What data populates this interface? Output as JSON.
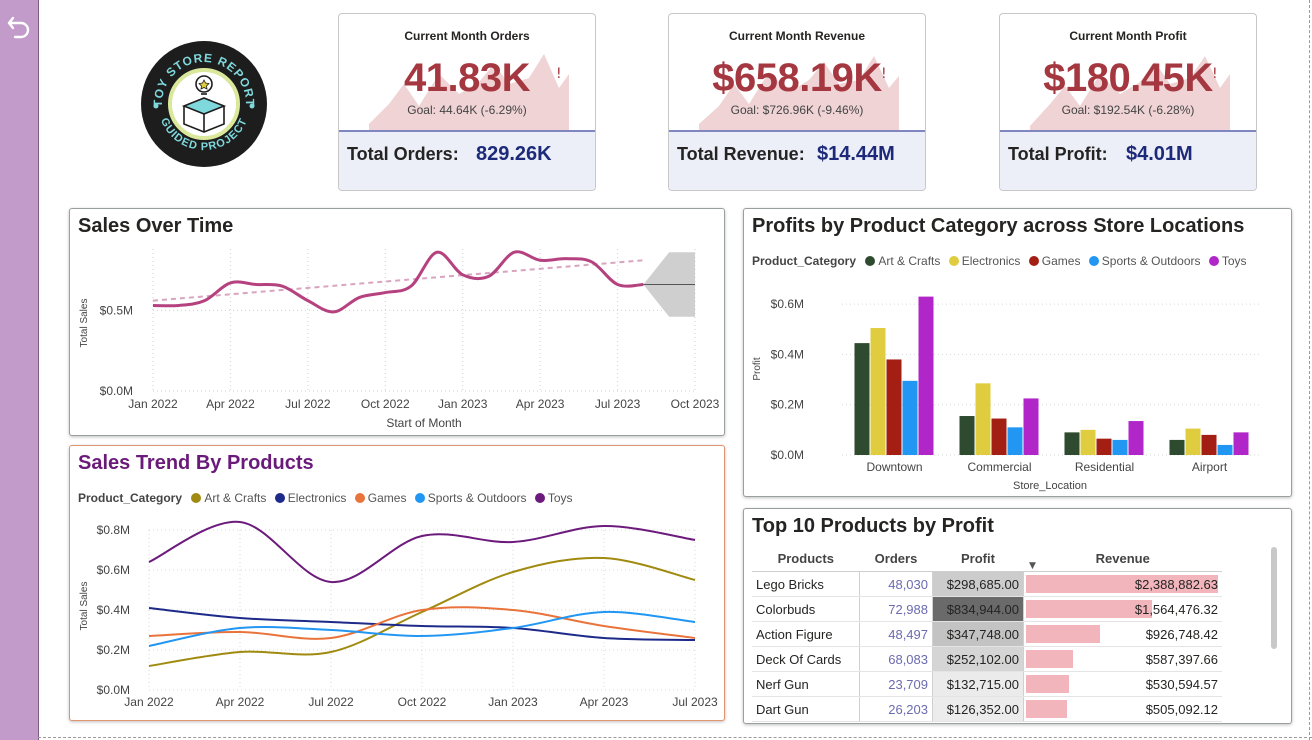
{
  "logo": {
    "top_text": "TOY STORE REPORT",
    "bottom_text": "GUIDED PROJECT"
  },
  "kpis": [
    {
      "title": "Current Month Orders",
      "value": "41.83K",
      "alert": "!",
      "goal": "Goal: 44.64K (-6.29%)",
      "total_label": "Total Orders:",
      "total_value": "829.26K"
    },
    {
      "title": "Current Month Revenue",
      "value": "$658.19K",
      "alert": "!",
      "goal": "Goal: $726.96K (-9.46%)",
      "total_label": "Total Revenue:",
      "total_value": "$14.44M"
    },
    {
      "title": "Current Month Profit",
      "value": "$180.45K",
      "alert": "!",
      "goal": "Goal: $192.54K (-6.28%)",
      "total_label": "Total Profit:",
      "total_value": "$4.01M"
    }
  ],
  "colors": {
    "kpi_value": "#a4373f",
    "total_value": "#1d2a7a",
    "sales_line": "#b6417f",
    "trend_line": "#d8a4bf",
    "art_crafts": "#2e4a2f",
    "electronics": "#e0cd3f",
    "games": "#a31f14",
    "sports_outdoors": "#2196f3",
    "toys": "#b026c8",
    "trend_art": "#a08a10",
    "trend_electronics": "#1d2a8a",
    "trend_games": "#e8743b",
    "trend_sports": "#2196f3",
    "trend_toys": "#6c1a7c",
    "revenue_bar": "#f2b5bc"
  },
  "chart_data": [
    {
      "type": "line",
      "title": "Sales Over Time",
      "xlabel": "Start of Month",
      "ylabel": "Total Sales",
      "x_tick_labels": [
        "Jan 2022",
        "Apr 2022",
        "Jul 2022",
        "Oct 2022",
        "Jan 2023",
        "Apr 2023",
        "Jul 2023",
        "Oct 2023"
      ],
      "y_tick_labels": [
        "$0.0M",
        "$0.5M"
      ],
      "ylim": [
        0,
        0.88
      ],
      "series": [
        {
          "x": [
            0,
            1,
            2,
            3,
            4,
            5,
            6,
            7,
            8,
            9,
            10,
            11,
            12,
            13,
            14,
            15,
            16,
            17,
            18,
            19
          ],
          "values": [
            0.53,
            0.53,
            0.56,
            0.67,
            0.66,
            0.65,
            0.56,
            0.49,
            0.58,
            0.61,
            0.65,
            0.86,
            0.72,
            0.71,
            0.86,
            0.81,
            0.82,
            0.8,
            0.66,
            0.66
          ]
        }
      ],
      "trend": {
        "x": [
          0,
          19
        ],
        "values": [
          0.56,
          0.81
        ]
      },
      "forecast": {
        "x": [
          19,
          20,
          21
        ],
        "values": [
          0.66,
          0.66,
          0.66
        ],
        "upper": [
          0.66,
          0.86,
          0.86
        ],
        "lower": [
          0.66,
          0.46,
          0.46
        ]
      },
      "grid": "dotted"
    },
    {
      "type": "line",
      "title": "Sales Trend By Products",
      "legend_title": "Product_Category",
      "xlabel": "",
      "ylabel": "Total Sales",
      "categories": [
        "Jan 2022",
        "Apr 2022",
        "Jul 2022",
        "Oct 2022",
        "Jan 2023",
        "Apr 2023",
        "Jul 2023"
      ],
      "y_tick_labels": [
        "$0.0M",
        "$0.2M",
        "$0.4M",
        "$0.6M",
        "$0.8M"
      ],
      "ylim": [
        0,
        0.8
      ],
      "series": [
        {
          "name": "Art & Crafts",
          "values": [
            0.12,
            0.19,
            0.19,
            0.39,
            0.59,
            0.66,
            0.55
          ]
        },
        {
          "name": "Electronics",
          "values": [
            0.41,
            0.36,
            0.34,
            0.32,
            0.31,
            0.26,
            0.25
          ]
        },
        {
          "name": "Games",
          "values": [
            0.27,
            0.29,
            0.26,
            0.4,
            0.4,
            0.32,
            0.26
          ]
        },
        {
          "name": "Sports & Outdoors",
          "values": [
            0.22,
            0.31,
            0.3,
            0.27,
            0.31,
            0.39,
            0.34
          ]
        },
        {
          "name": "Toys",
          "values": [
            0.64,
            0.84,
            0.54,
            0.77,
            0.74,
            0.82,
            0.75
          ]
        }
      ],
      "legend_position": "top-left"
    },
    {
      "type": "bar",
      "title": "Profits by Product Category across Store Locations",
      "legend_title": "Product_Category",
      "xlabel": "Store_Location",
      "ylabel": "Profit",
      "categories": [
        "Downtown",
        "Commercial",
        "Residential",
        "Airport"
      ],
      "y_tick_labels": [
        "$0.0M",
        "$0.2M",
        "$0.4M",
        "$0.6M"
      ],
      "ylim": [
        0,
        0.7
      ],
      "series": [
        {
          "name": "Art & Crafts",
          "values": [
            0.445,
            0.155,
            0.09,
            0.06
          ]
        },
        {
          "name": "Electronics",
          "values": [
            0.505,
            0.285,
            0.1,
            0.105
          ]
        },
        {
          "name": "Games",
          "values": [
            0.38,
            0.145,
            0.065,
            0.08
          ]
        },
        {
          "name": "Sports & Outdoors",
          "values": [
            0.295,
            0.11,
            0.06,
            0.04
          ]
        },
        {
          "name": "Toys",
          "values": [
            0.63,
            0.225,
            0.135,
            0.09
          ]
        }
      ],
      "legend_position": "top-left"
    },
    {
      "type": "table",
      "title": "Top 10 Products by Profit",
      "columns": [
        "Products",
        "Orders",
        "Profit",
        "Revenue"
      ],
      "rows": [
        {
          "product": "Lego Bricks",
          "orders": "48,030",
          "profit": "$298,685.00",
          "revenue": "$2,388,882.63",
          "revenue_value": 2388882.63
        },
        {
          "product": "Colorbuds",
          "orders": "72,988",
          "profit": "$834,944.00",
          "revenue": "$1,564,476.32",
          "revenue_value": 1564476.32
        },
        {
          "product": "Action Figure",
          "orders": "48,497",
          "profit": "$347,748.00",
          "revenue": "$926,748.42",
          "revenue_value": 926748.42
        },
        {
          "product": "Deck Of Cards",
          "orders": "68,083",
          "profit": "$252,102.00",
          "revenue": "$587,397.66",
          "revenue_value": 587397.66
        },
        {
          "product": "Nerf Gun",
          "orders": "23,709",
          "profit": "$132,715.00",
          "revenue": "$530,594.57",
          "revenue_value": 530594.57
        },
        {
          "product": "Dart Gun",
          "orders": "26,203",
          "profit": "$126,352.00",
          "revenue": "$505,092.12",
          "revenue_value": 505092.12
        }
      ]
    }
  ]
}
